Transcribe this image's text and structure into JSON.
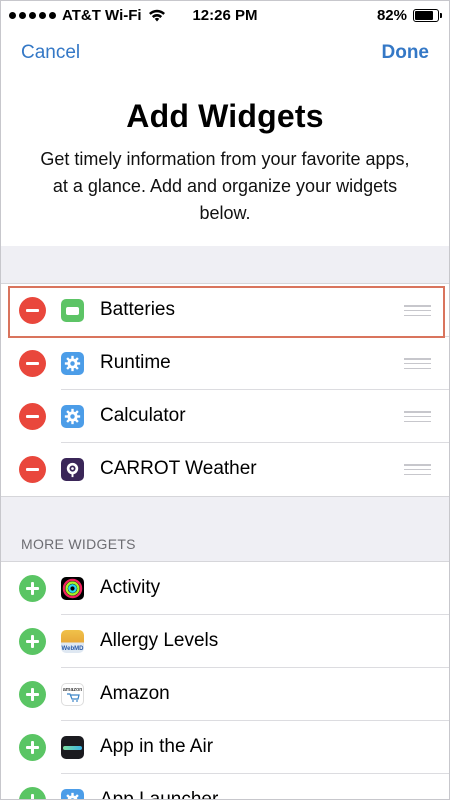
{
  "status_bar": {
    "carrier": "AT&T Wi-Fi",
    "time": "12:26 PM",
    "battery_percent": "82%",
    "battery_level": 0.82
  },
  "nav": {
    "cancel_label": "Cancel",
    "done_label": "Done"
  },
  "header": {
    "title": "Add Widgets",
    "subtitle": "Get timely information from your favorite apps, at a glance. Add and organize your widgets below."
  },
  "active_widgets": [
    {
      "label": "Batteries",
      "icon": "battery-widget-icon"
    },
    {
      "label": "Runtime",
      "icon": "gear-icon"
    },
    {
      "label": "Calculator",
      "icon": "gear-icon"
    },
    {
      "label": "CARROT Weather",
      "icon": "carrot-weather-icon"
    }
  ],
  "more_widgets": {
    "section_title": "MORE WIDGETS",
    "items": [
      {
        "label": "Activity",
        "icon": "activity-rings-icon"
      },
      {
        "label": "Allergy Levels",
        "icon": "webmd-icon"
      },
      {
        "label": "Amazon",
        "icon": "amazon-icon"
      },
      {
        "label": "App in the Air",
        "icon": "app-in-the-air-icon"
      },
      {
        "label": "App Launcher",
        "icon": "gear-icon"
      }
    ]
  },
  "icon_text": {
    "webmd": "WebMD",
    "amazon": "amazon"
  },
  "colors": {
    "accent": "#3478c6",
    "remove": "#e9473c",
    "add": "#5ac564",
    "highlight": "#d9745d"
  }
}
